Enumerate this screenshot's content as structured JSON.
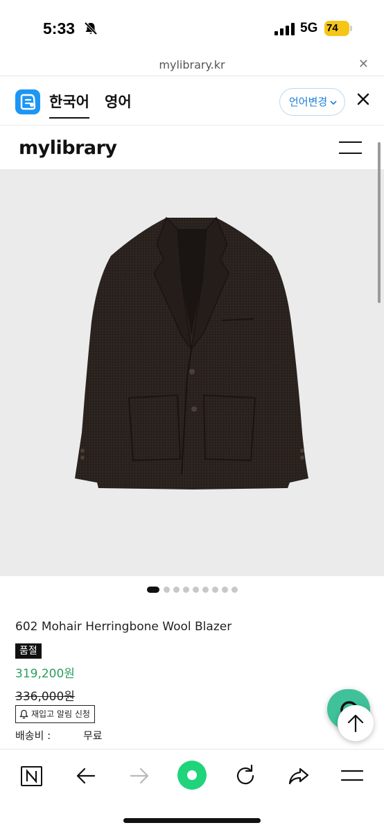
{
  "status_bar": {
    "time": "5:33",
    "network": "5G",
    "battery": "74"
  },
  "url_bar": {
    "url": "mylibrary.kr"
  },
  "translate_bar": {
    "tabs": [
      "한국어",
      "영어"
    ],
    "active_tab": "한국어",
    "change_language_label": "언어변경",
    "brand_color": "#1d96f3"
  },
  "site": {
    "logo": "mylibrary"
  },
  "gallery": {
    "dot_count": 9,
    "active_index": 0
  },
  "product": {
    "title": "602 Mohair Herringbone Wool Blazer",
    "badge": "품절",
    "sale_price": "319,200원",
    "original_price": "336,000원",
    "restock_label": "재입고 알림 신청",
    "shipping_label": "배송비 :",
    "shipping_value": "무료",
    "price_color": "#2a9d5c"
  },
  "floating": {
    "chat_color": "#3fc29a",
    "chat_icon": "chat-icon",
    "top_icon": "arrow-up-icon"
  },
  "bottom_bar": {
    "items": [
      "naver-icon",
      "back-arrow-icon",
      "forward-arrow-icon",
      "green-dot-icon",
      "refresh-icon",
      "share-icon",
      "menu-icon"
    ],
    "accent": "#1fd47a"
  }
}
